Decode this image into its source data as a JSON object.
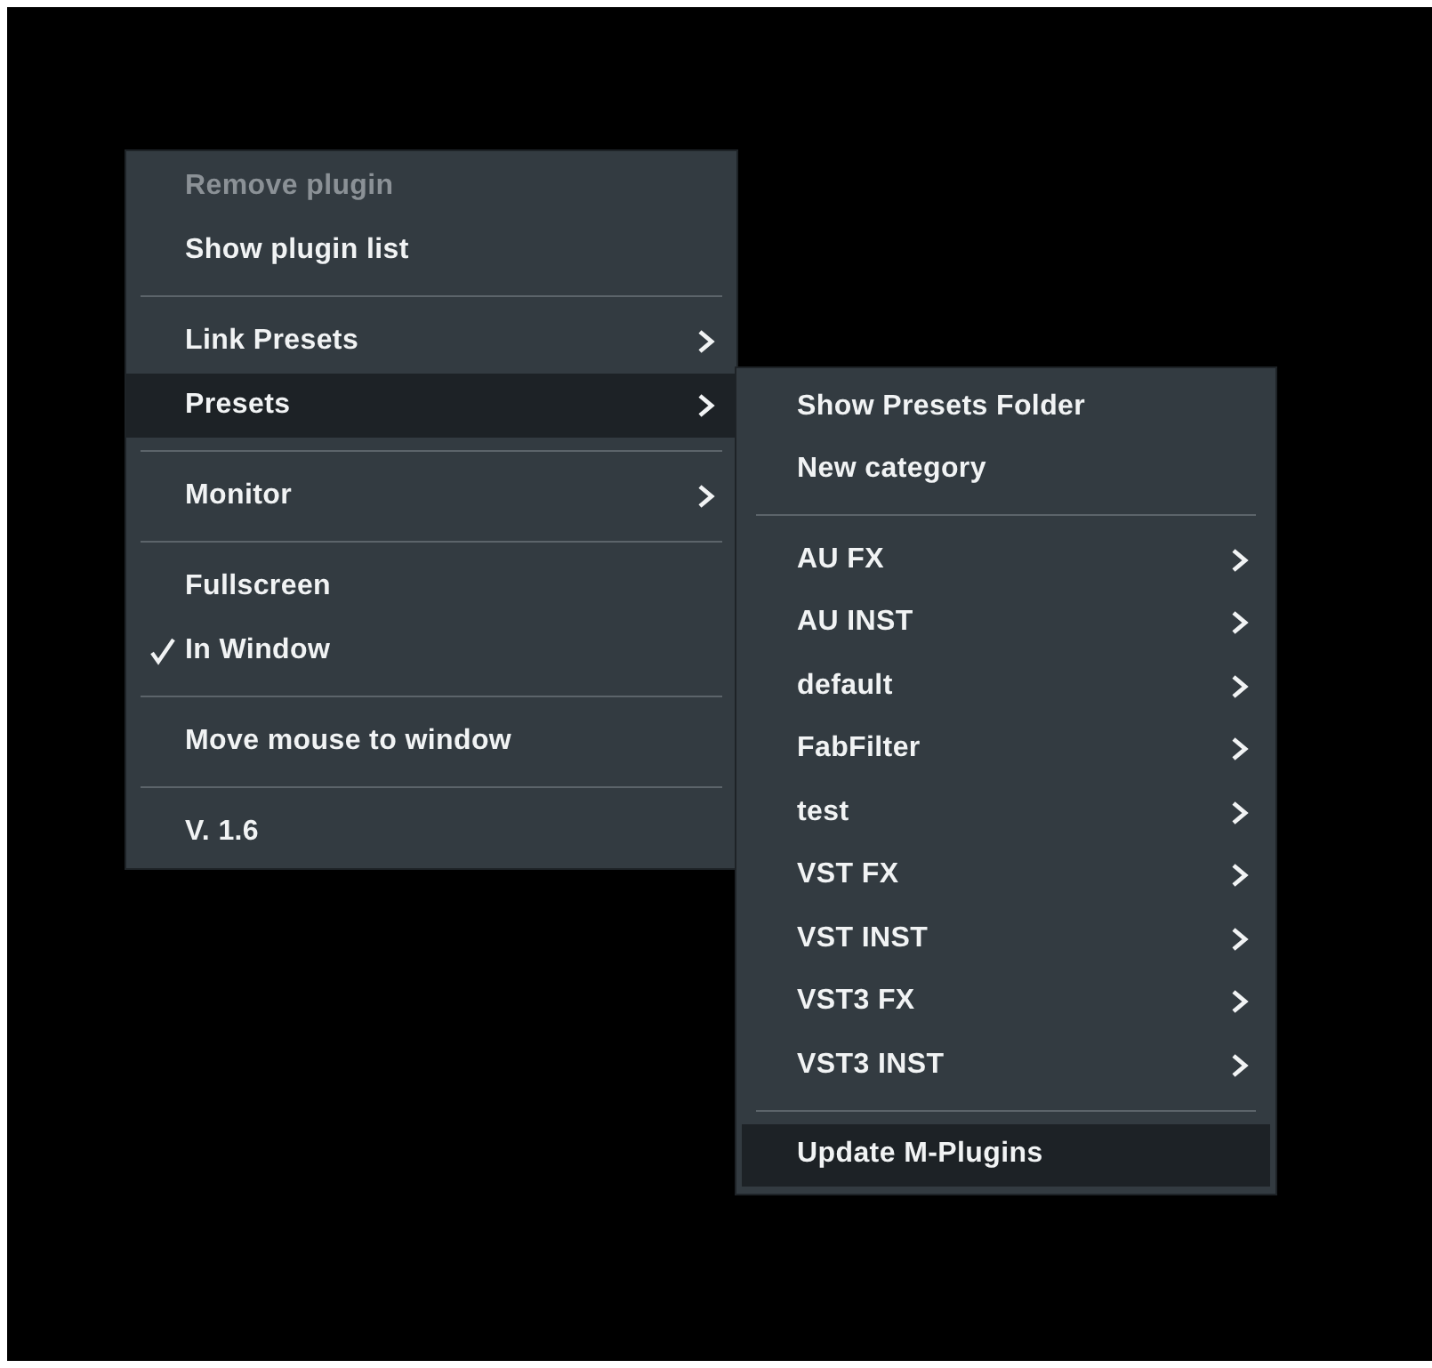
{
  "menus": [
    {
      "items": [
        {
          "kind": "item",
          "label": "Remove plugin",
          "disabled": true,
          "selected": false,
          "checked": false,
          "submenu": false
        },
        {
          "kind": "item",
          "label": "Show plugin list",
          "disabled": false,
          "selected": false,
          "checked": false,
          "submenu": false
        },
        {
          "kind": "separator"
        },
        {
          "kind": "item",
          "label": "Link Presets",
          "disabled": false,
          "selected": false,
          "checked": false,
          "submenu": true
        },
        {
          "kind": "item",
          "label": "Presets",
          "disabled": false,
          "selected": true,
          "checked": false,
          "submenu": true
        },
        {
          "kind": "separator"
        },
        {
          "kind": "item",
          "label": "Monitor",
          "disabled": false,
          "selected": false,
          "checked": false,
          "submenu": true
        },
        {
          "kind": "separator"
        },
        {
          "kind": "item",
          "label": "Fullscreen",
          "disabled": false,
          "selected": false,
          "checked": false,
          "submenu": false
        },
        {
          "kind": "item",
          "label": "In Window",
          "disabled": false,
          "selected": false,
          "checked": true,
          "submenu": false
        },
        {
          "kind": "separator"
        },
        {
          "kind": "item",
          "label": "Move mouse to window",
          "disabled": false,
          "selected": false,
          "checked": false,
          "submenu": false
        },
        {
          "kind": "separator"
        },
        {
          "kind": "item",
          "label": "V. 1.6",
          "disabled": false,
          "selected": false,
          "checked": false,
          "submenu": false
        }
      ]
    },
    {
      "items": [
        {
          "kind": "item",
          "label": "Show Presets Folder",
          "selected": false,
          "submenu": false
        },
        {
          "kind": "item",
          "label": "New category",
          "selected": false,
          "submenu": false
        },
        {
          "kind": "separator"
        },
        {
          "kind": "item",
          "label": "AU FX",
          "selected": false,
          "submenu": true
        },
        {
          "kind": "item",
          "label": "AU INST",
          "selected": false,
          "submenu": true
        },
        {
          "kind": "item",
          "label": "default",
          "selected": false,
          "submenu": true
        },
        {
          "kind": "item",
          "label": "FabFilter",
          "selected": false,
          "submenu": true
        },
        {
          "kind": "item",
          "label": "test",
          "selected": false,
          "submenu": true
        },
        {
          "kind": "item",
          "label": "VST FX",
          "selected": false,
          "submenu": true
        },
        {
          "kind": "item",
          "label": "VST INST",
          "selected": false,
          "submenu": true
        },
        {
          "kind": "item",
          "label": "VST3 FX",
          "selected": false,
          "submenu": true
        },
        {
          "kind": "item",
          "label": "VST3 INST",
          "selected": false,
          "submenu": true
        },
        {
          "kind": "separator"
        },
        {
          "kind": "item",
          "label": "Update M-Plugins",
          "selected": true,
          "submenu": false
        }
      ]
    }
  ]
}
